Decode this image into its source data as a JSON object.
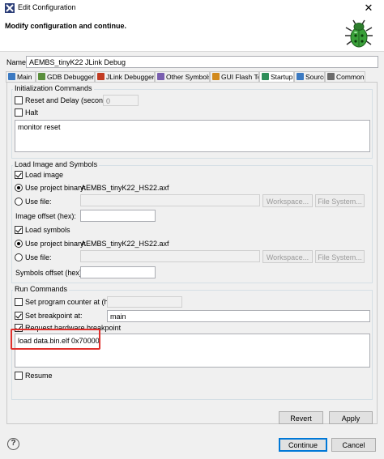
{
  "window": {
    "title": "Edit Configuration",
    "close": "✕"
  },
  "header": {
    "message": "Modify configuration and continue."
  },
  "name_field": {
    "label": "Name:",
    "value": "AEMBS_tinyK22 JLink Debug"
  },
  "tabs": [
    {
      "label": "Main",
      "icon": "main-tab-icon",
      "color": "#3c7ac2",
      "active": false
    },
    {
      "label": "GDB Debugger",
      "icon": "debugger-icon",
      "color": "#5a8f3c",
      "active": false
    },
    {
      "label": "JLink Debugger",
      "icon": "jlink-icon",
      "color": "#c23b22",
      "active": false
    },
    {
      "label": "Other Symbols",
      "icon": "symbols-icon",
      "color": "#7a5fb0",
      "active": false
    },
    {
      "label": "GUI Flash Tool",
      "icon": "flash-icon",
      "color": "#d28a1e",
      "active": false
    },
    {
      "label": "Startup",
      "icon": "startup-icon",
      "color": "#2f8f5a",
      "active": true
    },
    {
      "label": "Source",
      "icon": "source-icon",
      "color": "#3c7ac2",
      "active": false
    },
    {
      "label": "Common",
      "icon": "common-icon",
      "color": "#6b6b6b",
      "active": false
    }
  ],
  "init": {
    "title": "Initialization Commands",
    "reset_label": "Reset and Delay (seconds):",
    "reset_value": "0",
    "halt_label": "Halt",
    "commands": "monitor reset"
  },
  "load": {
    "title": "Load Image and Symbols",
    "load_image_label": "Load image",
    "use_project_binary_label": "Use project binary:",
    "project_binary_value": "AEMBS_tinyK22_HS22.axf",
    "use_file_label": "Use file:",
    "workspace_label": "Workspace...",
    "filesystem_label": "File System...",
    "image_offset_label": "Image offset (hex):",
    "load_symbols_label": "Load symbols",
    "symbols_binary_label": "Use project binary:",
    "symbols_binary_value": "AEMBS_tinyK22_HS22.axf",
    "symbols_file_label": "Use file:",
    "symbols_workspace_label": "Workspace...",
    "symbols_filesystem_label": "File System...",
    "symbols_offset_label": "Symbols offset (hex):"
  },
  "run": {
    "title": "Run Commands",
    "set_pc_label": "Set program counter at (hex):",
    "breakpoint_label": "Set breakpoint at:",
    "breakpoint_value": "main",
    "hw_breakpoint_label": "Request hardware breakpoint",
    "commands": "load data.bin.elf 0x70000",
    "resume_label": "Resume"
  },
  "buttons": {
    "revert": "Revert",
    "apply": "Apply",
    "continue": "Continue",
    "cancel": "Cancel",
    "help": "?"
  }
}
